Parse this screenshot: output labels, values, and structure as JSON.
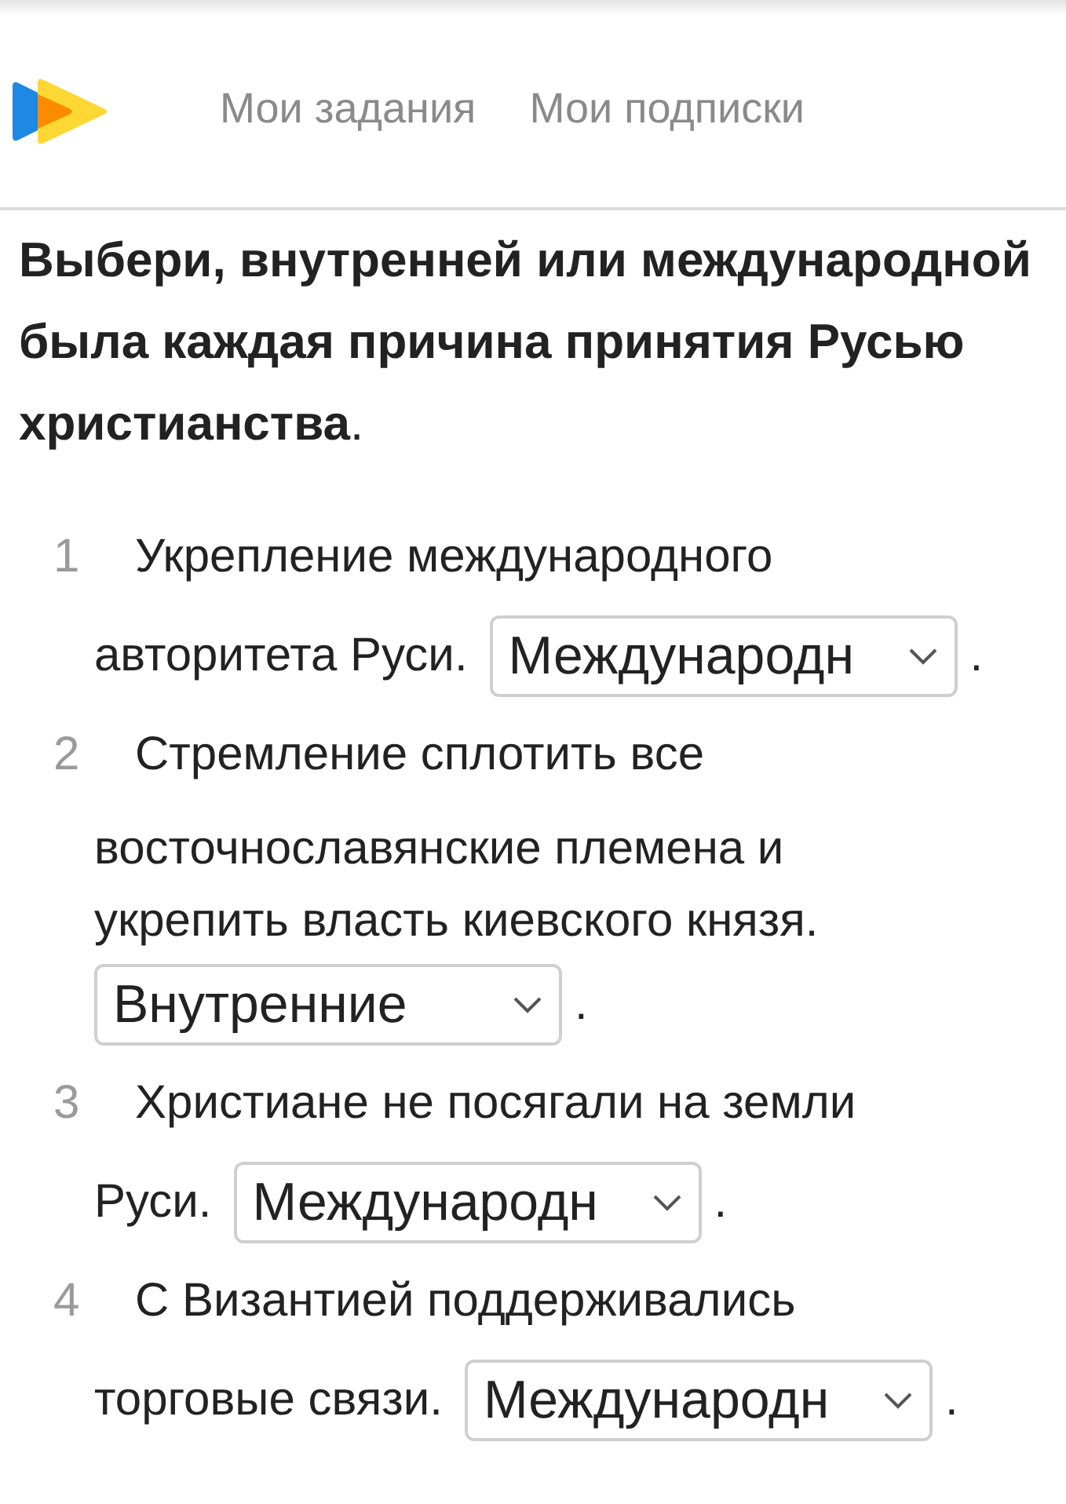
{
  "nav": {
    "links": [
      "Мои задания",
      "Мои подписки"
    ]
  },
  "question": "**Выбери, внутренней или международной была каждая причина принятия Русью христианства**.",
  "items": [
    {
      "number": "1",
      "lines": [
        "Укрепление международного",
        "авторитета Руси."
      ],
      "value": "Международн",
      "suffix": "."
    },
    {
      "number": "2",
      "lines": [
        "Стремление сплотить все",
        "восточнославянские племена и",
        "укрепить власть киевского князя."
      ],
      "value": "Внутренние",
      "suffix": "."
    },
    {
      "number": "3",
      "lines": [
        "Христиане не посягали на земли",
        "Руси."
      ],
      "value": "Международн",
      "suffix": "."
    },
    {
      "number": "4",
      "lines": [
        "С Византией поддерживались",
        "торговые связи."
      ],
      "value": "Международн",
      "suffix": "."
    }
  ]
}
